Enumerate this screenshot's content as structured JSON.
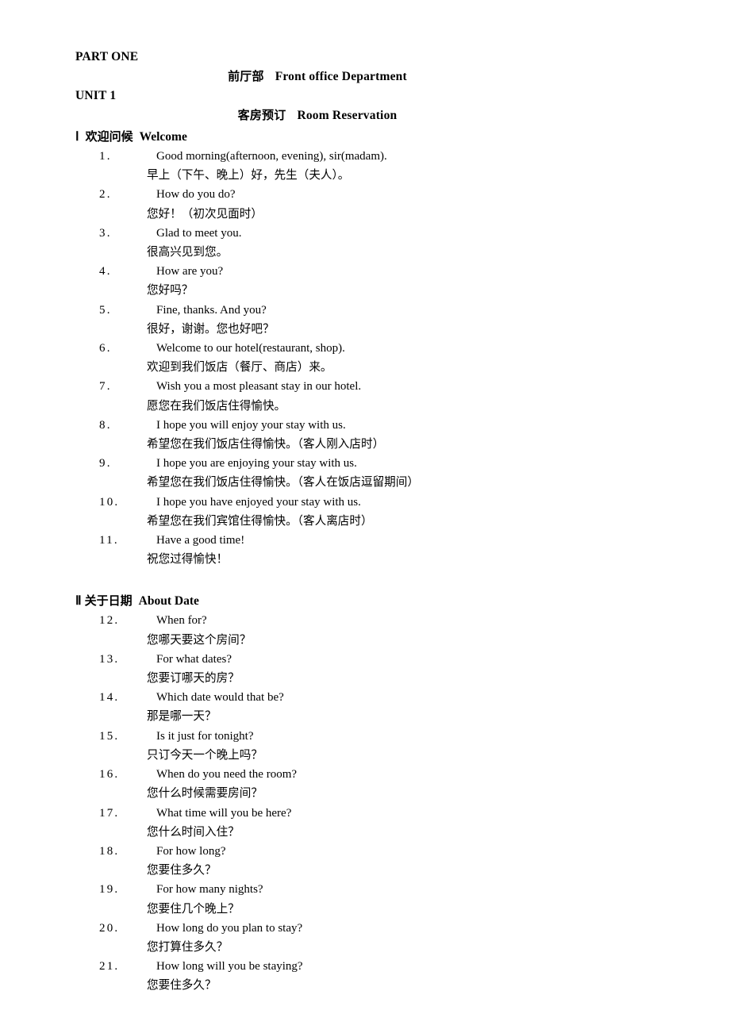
{
  "document": {
    "part_heading": "PART ONE",
    "unit_heading": "UNIT 1",
    "title_department": {
      "cn": "前厅部",
      "en": "Front office Department"
    },
    "title_unit": {
      "cn": "客房预订",
      "en": "Room Reservation"
    }
  },
  "sections": [
    {
      "numeral": "Ⅰ",
      "cn": "欢迎问候",
      "en": "Welcome",
      "spacing": "wide",
      "entries": [
        {
          "num": "1.",
          "en": "Good morning(afternoon, evening), sir(madam).",
          "cn": "早上（下午、晚上）好，先生（夫人）。"
        },
        {
          "num": "2.",
          "en": "How do you do?",
          "cn": "您好！（初次见面时）"
        },
        {
          "num": "3.",
          "en": "Glad to meet you.",
          "cn": "很高兴见到您。"
        },
        {
          "num": "4.",
          "en": "How are you?",
          "cn": "您好吗？"
        },
        {
          "num": "5.",
          "en": "Fine, thanks. And you?",
          "cn": "很好，谢谢。您也好吧？"
        },
        {
          "num": "6.",
          "en": "Welcome to our hotel(restaurant, shop).",
          "cn": "欢迎到我们饭店（餐厅、商店）来。"
        },
        {
          "num": "7.",
          "en": "Wish you a most pleasant stay in our hotel.",
          "cn": "愿您在我们饭店住得愉快。"
        },
        {
          "num": "8.",
          "en": "I hope you will enjoy your stay with us.",
          "cn": "希望您在我们饭店住得愉快。（客人刚入店时）"
        },
        {
          "num": "9.",
          "en": "I hope you are enjoying your stay with us.",
          "cn": "希望您在我们饭店住得愉快。（客人在饭店逗留期间）"
        },
        {
          "num": "10.",
          "en": "I hope you have enjoyed your stay with us.",
          "cn": "希望您在我们宾馆住得愉快。（客人离店时）"
        },
        {
          "num": "11.",
          "en": "Have a good time!",
          "cn": "祝您过得愉快！"
        }
      ]
    },
    {
      "numeral": "Ⅱ",
      "cn": "关于日期",
      "en": "About Date",
      "spacing": "thin",
      "entries": [
        {
          "num": "12.",
          "en": "When for?",
          "cn": "您哪天要这个房间？"
        },
        {
          "num": "13.",
          "en": "For what dates?",
          "cn": "您要订哪天的房？"
        },
        {
          "num": "14.",
          "en": "Which date would that be?",
          "cn": "那是哪一天？"
        },
        {
          "num": "15.",
          "en": "Is it just for tonight?",
          "cn": "只订今天一个晚上吗？"
        },
        {
          "num": "16.",
          "en": "When do you need the room?",
          "cn": "您什么时候需要房间？"
        },
        {
          "num": "17.",
          "en": "What time will you be here?",
          "cn": "您什么时间入住？"
        },
        {
          "num": "18.",
          "en": "For how long?",
          "cn": "您要住多久？"
        },
        {
          "num": "19.",
          "en": "For how many nights?",
          "cn": "您要住几个晚上？"
        },
        {
          "num": "20.",
          "en": "How long do you plan to stay?",
          "cn": "您打算住多久？"
        },
        {
          "num": "21.",
          "en": "How long will you be staying?",
          "cn": "您要住多久？"
        }
      ]
    }
  ]
}
